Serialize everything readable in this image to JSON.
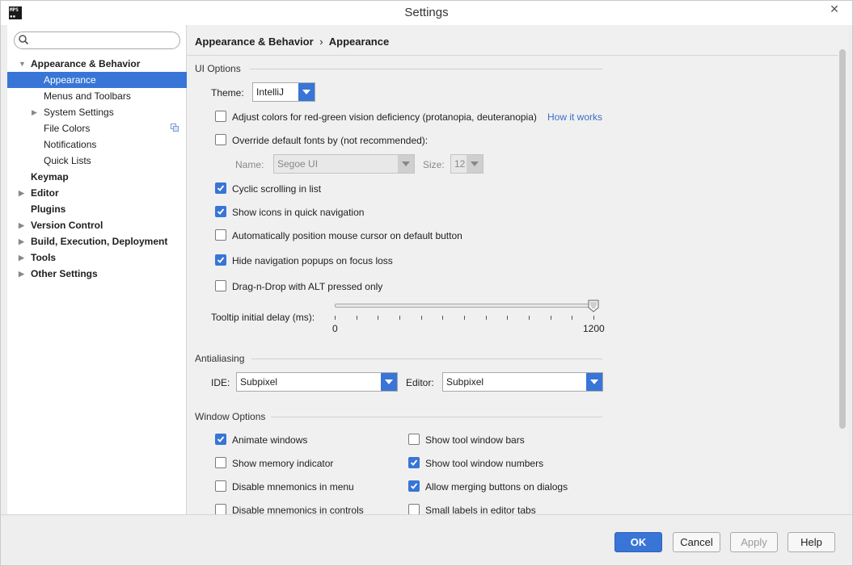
{
  "window": {
    "title": "Settings",
    "app_icon_text_1": "MPS",
    "app_icon_text_2": "▪▪"
  },
  "search": {
    "placeholder": ""
  },
  "sidebar": {
    "items": [
      {
        "label": "Appearance & Behavior",
        "expanded": true
      },
      {
        "label": "Appearance",
        "selected": true
      },
      {
        "label": "Menus and Toolbars"
      },
      {
        "label": "System Settings"
      },
      {
        "label": "File Colors"
      },
      {
        "label": "Notifications"
      },
      {
        "label": "Quick Lists"
      },
      {
        "label": "Keymap"
      },
      {
        "label": "Editor"
      },
      {
        "label": "Plugins"
      },
      {
        "label": "Version Control"
      },
      {
        "label": "Build, Execution, Deployment"
      },
      {
        "label": "Tools"
      },
      {
        "label": "Other Settings"
      }
    ]
  },
  "breadcrumb": {
    "parent": "Appearance & Behavior",
    "separator": "›",
    "current": "Appearance"
  },
  "ui_options": {
    "section": "UI Options",
    "theme_label": "Theme:",
    "theme_value": "IntelliJ",
    "adjust_colors": {
      "label": "Adjust colors for red-green vision deficiency (protanopia, deuteranopia)",
      "checked": false
    },
    "how_it_works": "How it works",
    "override_fonts": {
      "label": "Override default fonts by (not recommended):",
      "checked": false
    },
    "font_name_label": "Name:",
    "font_name_value": "Segoe UI",
    "font_size_label": "Size:",
    "font_size_value": "12",
    "cyclic_scrolling": {
      "label": "Cyclic scrolling in list",
      "checked": true
    },
    "show_icons_nav": {
      "label": "Show icons in quick navigation",
      "checked": true
    },
    "auto_cursor": {
      "label": "Automatically position mouse cursor on default button",
      "checked": false
    },
    "hide_nav_popups": {
      "label": "Hide navigation popups on focus loss",
      "checked": true
    },
    "drag_drop_alt": {
      "label": "Drag-n-Drop with ALT pressed only",
      "checked": false
    },
    "tooltip_label": "Tooltip initial delay (ms):",
    "tooltip_min": "0",
    "tooltip_max": "1200",
    "tooltip_value_fraction": 1.0
  },
  "antialiasing": {
    "section": "Antialiasing",
    "ide_label": "IDE:",
    "ide_value": "Subpixel",
    "editor_label": "Editor:",
    "editor_value": "Subpixel"
  },
  "window_options": {
    "section": "Window Options",
    "left": [
      {
        "label": "Animate windows",
        "checked": true
      },
      {
        "label": "Show memory indicator",
        "checked": false
      },
      {
        "label": "Disable mnemonics in menu",
        "checked": false
      },
      {
        "label": "Disable mnemonics in controls",
        "checked": false
      }
    ],
    "right": [
      {
        "label": "Show tool window bars",
        "checked": false
      },
      {
        "label": "Show tool window numbers",
        "checked": true
      },
      {
        "label": "Allow merging buttons on dialogs",
        "checked": true
      },
      {
        "label": "Small labels in editor tabs",
        "checked": false
      }
    ]
  },
  "footer": {
    "ok": "OK",
    "cancel": "Cancel",
    "apply": "Apply",
    "help": "Help"
  },
  "colors": {
    "accent": "#3875d7",
    "link": "#3a6fc4"
  }
}
